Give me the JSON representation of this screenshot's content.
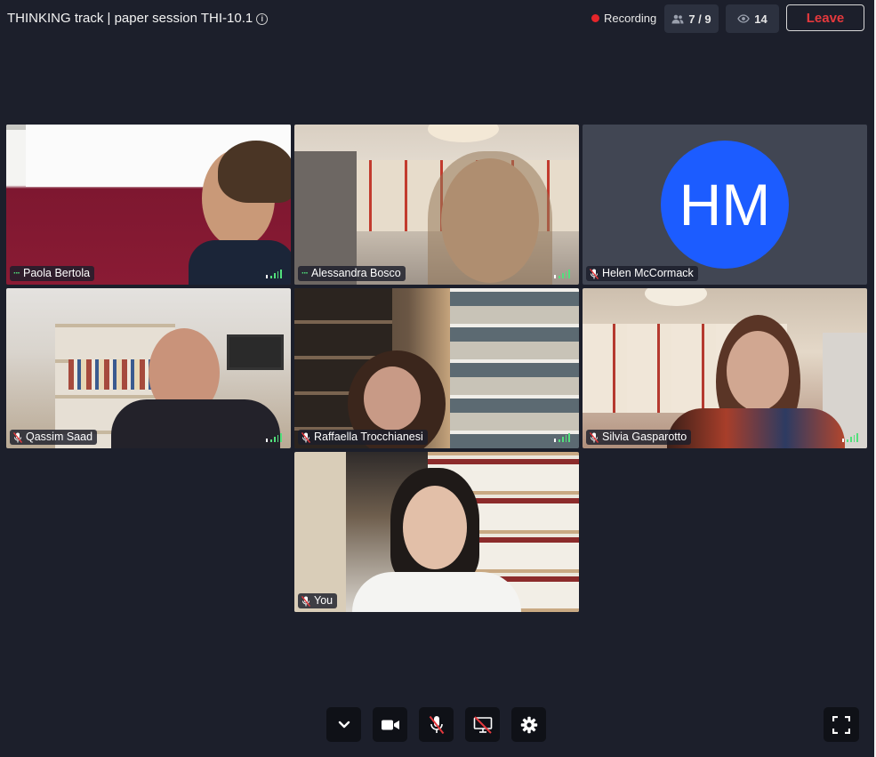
{
  "header": {
    "title": "THINKING track | paper session THI-10.1",
    "recording_label": "Recording",
    "participants_count": "7 / 9",
    "viewers_count": "14",
    "leave_label": "Leave"
  },
  "participants": [
    {
      "name": "Paola Bertola",
      "status": "speaking-dots"
    },
    {
      "name": "Alessandra Bosco",
      "status": "speaking-dots"
    },
    {
      "name": "Helen McCormack",
      "status": "muted",
      "initials": "HM"
    },
    {
      "name": "Qassim Saad",
      "status": "muted"
    },
    {
      "name": "Raffaella Trocchianesi",
      "status": "muted"
    },
    {
      "name": "Silvia Gasparotto",
      "status": "muted"
    },
    {
      "name": "You",
      "status": "muted"
    }
  ],
  "toolbar": {
    "icons": [
      "chevron-down-icon",
      "camera-icon",
      "mic-off-icon",
      "screen-share-off-icon",
      "gear-icon"
    ],
    "fullscreen_icon": "fullscreen-icon"
  },
  "colors": {
    "background": "#1c1f2b",
    "leave": "#e5393d",
    "recording": "#e5252a",
    "avatar": "#1c5cff",
    "signal": "#52e07c"
  }
}
